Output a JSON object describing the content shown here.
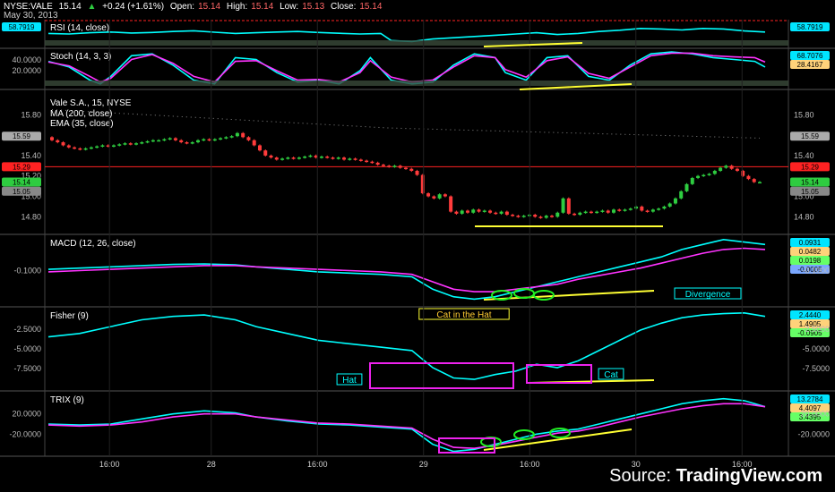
{
  "header": {
    "symbol": "NYSE:VALE",
    "price": "15.14",
    "change": "+0.24 (+1.61%)",
    "open_label": "Open:",
    "open": "15.14",
    "high_label": "High:",
    "high": "15.14",
    "low_label": "Low:",
    "low": "15.13",
    "close_label": "Close:",
    "close": "15.14",
    "date": "May 30, 2013"
  },
  "watermark": {
    "prefix": "Source: ",
    "brand": "TradingView.com"
  },
  "colors": {
    "bg": "#000000",
    "up": "#2ecc40",
    "down": "#ff3b3b",
    "annot_yellow": "#ffff33",
    "annot_green": "#22ee22",
    "annot_magenta": "#ee22ee",
    "hline": "#ff2222"
  },
  "chart_data": [
    {
      "type": "line",
      "panel": "rsi",
      "title": "RSI (14, close)",
      "ylim": [
        0,
        100
      ],
      "right_badges": [
        "58.7919"
      ],
      "left_badges": [
        "58.7919"
      ],
      "x": [
        0,
        4,
        8,
        12,
        16,
        20,
        24,
        28,
        32,
        36,
        40,
        44,
        48,
        52,
        56,
        60,
        64,
        66,
        70,
        74,
        78,
        82,
        86,
        90,
        94,
        98,
        102,
        106,
        110,
        114,
        118,
        122,
        126,
        130,
        134,
        138
      ],
      "series": [
        {
          "values": [
            52,
            50,
            55,
            58,
            54,
            56,
            60,
            63,
            57,
            52,
            55,
            58,
            60,
            56,
            53,
            50,
            52,
            24,
            20,
            30,
            35,
            40,
            45,
            50,
            55,
            48,
            52,
            60,
            65,
            72,
            70,
            66,
            72,
            70,
            62,
            58
          ]
        }
      ]
    },
    {
      "type": "line",
      "panel": "stoch",
      "title": "Stoch (14, 3, 3)",
      "ylim": [
        0,
        100
      ],
      "ticks": [
        "40.0000",
        "20.0000"
      ],
      "right_badges": [
        "68.7076",
        "28.4167"
      ],
      "x": [
        0,
        4,
        8,
        10,
        12,
        16,
        20,
        24,
        28,
        32,
        36,
        40,
        44,
        48,
        52,
        56,
        60,
        62,
        66,
        70,
        74,
        78,
        82,
        86,
        88,
        92,
        96,
        100,
        104,
        108,
        112,
        116,
        120,
        124,
        128,
        132,
        136,
        138
      ],
      "series": [
        {
          "values": [
            70,
            55,
            20,
            10,
            30,
            85,
            90,
            60,
            20,
            10,
            80,
            75,
            40,
            15,
            20,
            10,
            45,
            80,
            20,
            10,
            15,
            60,
            90,
            80,
            40,
            20,
            80,
            85,
            30,
            20,
            60,
            90,
            95,
            90,
            80,
            75,
            70,
            55
          ]
        },
        {
          "values": [
            68,
            58,
            30,
            15,
            25,
            75,
            88,
            65,
            30,
            15,
            70,
            72,
            45,
            20,
            22,
            15,
            40,
            72,
            28,
            15,
            20,
            55,
            85,
            80,
            48,
            28,
            72,
            82,
            38,
            25,
            55,
            85,
            92,
            92,
            85,
            82,
            80,
            68
          ]
        }
      ]
    },
    {
      "type": "candlestick",
      "panel": "price",
      "title": "Vale S.A., 15, NYSE",
      "indicators": [
        "MA (200, close)",
        "EMA (35, close)"
      ],
      "ylim": [
        14.68,
        15.96
      ],
      "y_ticks": [
        15.8,
        15.6,
        15.4,
        15.2,
        15.0,
        14.8
      ],
      "tick_labels": [
        "15.80",
        "15.60",
        "15.40",
        "15.20",
        "15.00",
        "14.80"
      ],
      "right_badges": [
        "15.59",
        "15.29",
        "15.20",
        "15.14",
        "15.05"
      ],
      "left_badges": [
        "15.59",
        "15.29",
        "15.14",
        "15.05"
      ],
      "hline": 15.29,
      "x_ticks": [
        {
          "x": 13,
          "label": "16:00"
        },
        {
          "x": 36,
          "label": "28"
        },
        {
          "x": 60,
          "label": "16:00"
        },
        {
          "x": 84,
          "label": "29"
        },
        {
          "x": 108,
          "label": "16:00"
        },
        {
          "x": 132,
          "label": "30"
        },
        {
          "x": 156,
          "label": "16:00"
        }
      ],
      "closes": [
        15.55,
        15.53,
        15.5,
        15.48,
        15.47,
        15.46,
        15.47,
        15.48,
        15.49,
        15.5,
        15.49,
        15.5,
        15.51,
        15.52,
        15.51,
        15.52,
        15.53,
        15.54,
        15.55,
        15.55,
        15.56,
        15.57,
        15.55,
        15.53,
        15.52,
        15.53,
        15.55,
        15.56,
        15.55,
        15.56,
        15.57,
        15.58,
        15.59,
        15.62,
        15.58,
        15.55,
        15.5,
        15.45,
        15.4,
        15.38,
        15.36,
        15.37,
        15.38,
        15.37,
        15.38,
        15.39,
        15.4,
        15.38,
        15.39,
        15.38,
        15.37,
        15.38,
        15.36,
        15.37,
        15.36,
        15.35,
        15.34,
        15.33,
        15.31,
        15.3,
        15.29,
        15.3,
        15.28,
        15.27,
        15.25,
        15.21,
        15.03,
        15.0,
        14.98,
        15.02,
        15.0,
        14.85,
        14.83,
        14.86,
        14.84,
        14.87,
        14.85,
        14.86,
        14.84,
        14.83,
        14.85,
        14.82,
        14.81,
        14.8,
        14.81,
        14.82,
        14.8,
        14.79,
        14.81,
        14.8,
        14.84,
        14.98,
        14.83,
        14.82,
        14.84,
        14.85,
        14.84,
        14.85,
        14.86,
        14.84,
        14.87,
        14.86,
        14.87,
        14.88,
        14.9,
        14.86,
        14.85,
        14.87,
        14.88,
        14.9,
        14.93,
        14.98,
        15.05,
        15.12,
        15.18,
        15.2,
        15.21,
        15.22,
        15.25,
        15.28,
        15.3,
        15.27,
        15.25,
        15.2,
        15.17,
        15.14,
        15.14
      ]
    },
    {
      "type": "line",
      "panel": "macd",
      "title": "MACD (12, 26, close)",
      "y_ticks": [
        "-0.1000"
      ],
      "right_badges": [
        "0.0931",
        "0.0482",
        "0.0198",
        "-0.0005"
      ],
      "x": [
        0,
        6,
        12,
        18,
        24,
        30,
        36,
        40,
        46,
        52,
        58,
        64,
        70,
        74,
        78,
        82,
        86,
        90,
        94,
        98,
        102,
        106,
        110,
        114,
        118,
        122,
        126,
        130,
        134,
        138
      ],
      "series": [
        {
          "values": [
            -0.01,
            -0.005,
            0.0,
            0.005,
            0.01,
            0.012,
            0.008,
            0.0,
            -0.01,
            -0.02,
            -0.025,
            -0.03,
            -0.04,
            -0.09,
            -0.12,
            -0.13,
            -0.12,
            -0.1,
            -0.08,
            -0.06,
            -0.04,
            -0.02,
            0.0,
            0.02,
            0.04,
            0.07,
            0.09,
            0.11,
            0.1,
            0.09
          ]
        },
        {
          "values": [
            -0.02,
            -0.015,
            -0.01,
            -0.005,
            0.0,
            0.005,
            0.005,
            0.0,
            -0.005,
            -0.01,
            -0.015,
            -0.02,
            -0.03,
            -0.06,
            -0.09,
            -0.1,
            -0.1,
            -0.09,
            -0.08,
            -0.07,
            -0.05,
            -0.035,
            -0.02,
            -0.005,
            0.015,
            0.035,
            0.055,
            0.07,
            0.075,
            0.07
          ]
        }
      ],
      "annotations": [
        "Divergence"
      ]
    },
    {
      "type": "line",
      "panel": "fisher",
      "title": "Fisher (9)",
      "y_ticks": [
        "-2.5000",
        "-5.0000",
        "-7.5000"
      ],
      "right_badges": [
        "2.4440",
        "1.4905",
        "-0.0905"
      ],
      "x": [
        0,
        6,
        12,
        18,
        24,
        30,
        36,
        40,
        46,
        52,
        58,
        64,
        70,
        74,
        78,
        82,
        86,
        90,
        94,
        98,
        102,
        106,
        110,
        114,
        118,
        122,
        126,
        130,
        134,
        138
      ],
      "series": [
        {
          "values": [
            -1.0,
            -0.5,
            0.5,
            1.5,
            2.0,
            2.2,
            1.5,
            0.5,
            -0.5,
            -1.5,
            -2.0,
            -2.5,
            -3.0,
            -5.5,
            -7.0,
            -7.2,
            -6.5,
            -6.0,
            -5.0,
            -5.5,
            -4.5,
            -3.0,
            -1.5,
            0.0,
            1.0,
            1.8,
            2.2,
            2.4,
            2.5,
            2.0
          ]
        }
      ],
      "annotations": [
        "Cat in the Hat",
        "Hat",
        "Cat"
      ]
    },
    {
      "type": "line",
      "panel": "trix",
      "title": "TRIX (9)",
      "y_ticks": [
        "20.0000",
        "-20.0000"
      ],
      "right_badges": [
        "13.2784",
        "4.4097",
        "3.4395"
      ],
      "x": [
        0,
        6,
        12,
        18,
        24,
        30,
        36,
        40,
        46,
        52,
        58,
        64,
        70,
        74,
        78,
        82,
        86,
        90,
        94,
        98,
        102,
        106,
        110,
        114,
        118,
        122,
        126,
        130,
        134,
        138
      ],
      "series": [
        {
          "values": [
            -5,
            -6,
            -5,
            0,
            5,
            8,
            6,
            2,
            -2,
            -5,
            -6,
            -8,
            -10,
            -25,
            -32,
            -30,
            -25,
            -20,
            -15,
            -12,
            -10,
            -5,
            0,
            5,
            10,
            15,
            18,
            20,
            18,
            12
          ]
        },
        {
          "values": [
            -6,
            -7,
            -6,
            -3,
            2,
            5,
            5,
            2,
            -1,
            -4,
            -5,
            -7,
            -9,
            -20,
            -28,
            -29,
            -26,
            -22,
            -18,
            -14,
            -12,
            -8,
            -3,
            2,
            6,
            10,
            13,
            15,
            15,
            12
          ]
        }
      ]
    }
  ]
}
